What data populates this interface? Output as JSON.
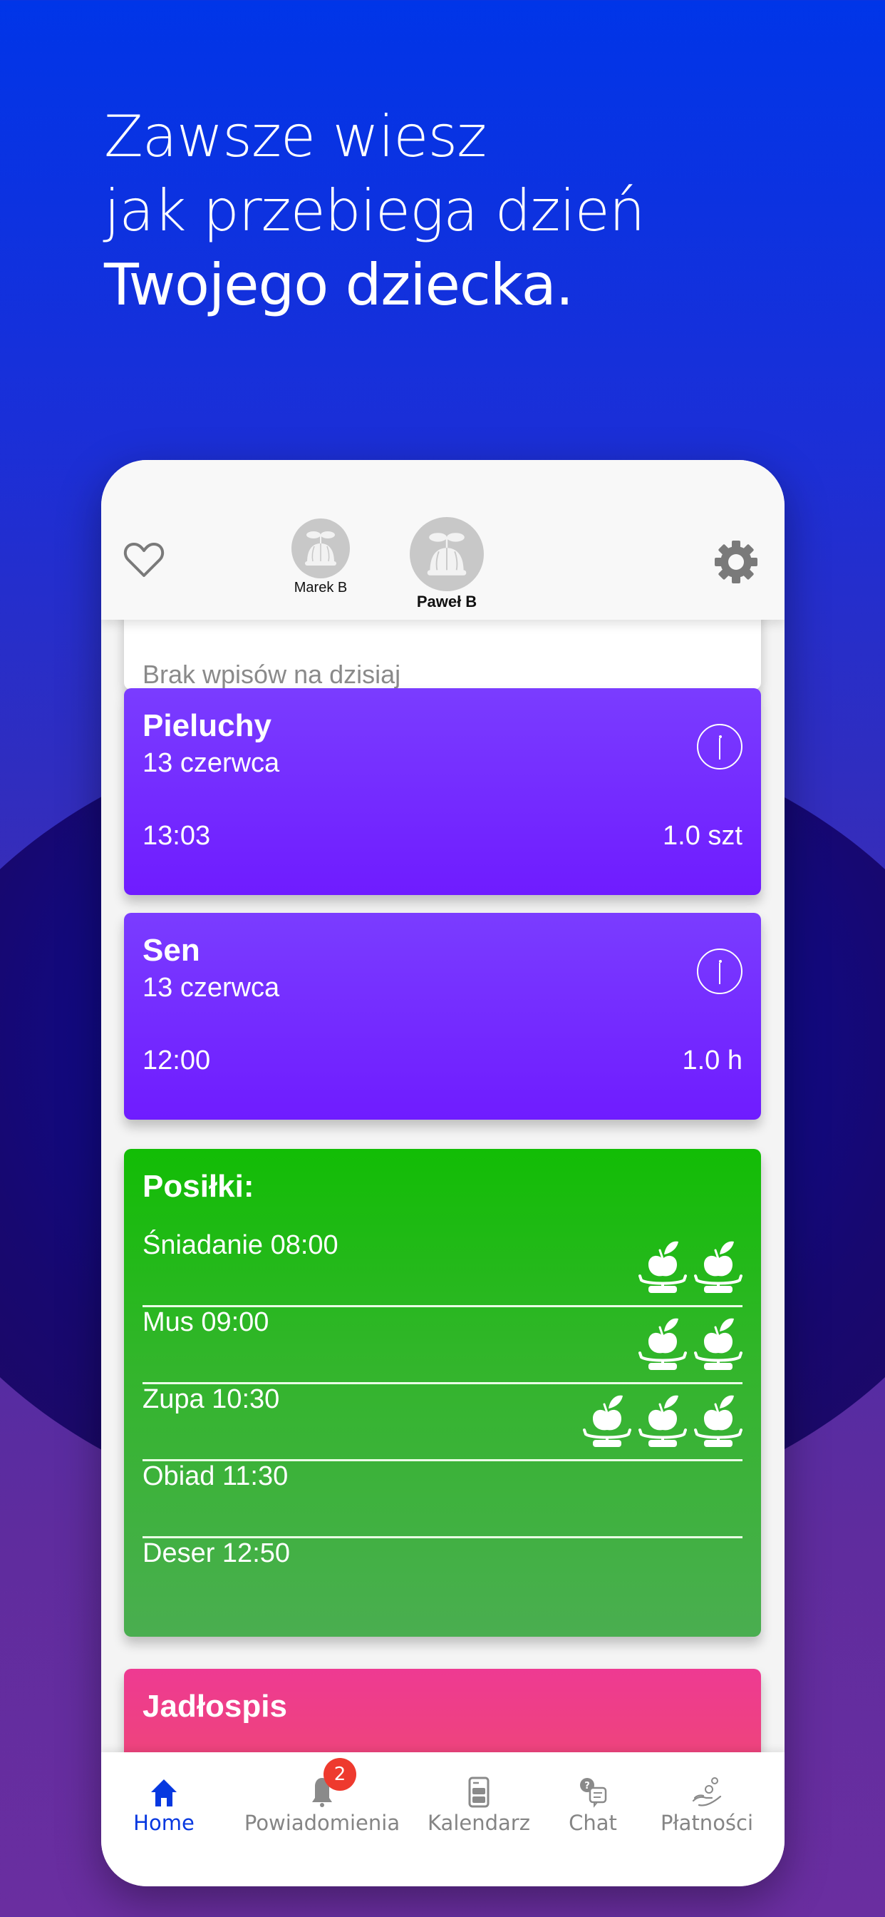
{
  "headline": {
    "line1": "Zawsze wiesz",
    "line2": "jak przebiega dzień",
    "line3": "Twojego dziecka."
  },
  "topbar": {
    "children": [
      {
        "name": "Marek B",
        "selected": false
      },
      {
        "name": "Paweł B",
        "selected": true
      }
    ]
  },
  "feed": {
    "empty_text": "Brak wpisów na dzisiaj",
    "cards": [
      {
        "title": "Pieluchy",
        "date": "13 czerwca",
        "time": "13:03",
        "quantity": "1.0 szt",
        "color": "#7228ff"
      },
      {
        "title": "Sen",
        "date": "13 czerwca",
        "time": "12:00",
        "quantity": "1.0 h",
        "color": "#7228ff"
      }
    ],
    "meals": {
      "title": "Posiłki:",
      "color": "#22b81a",
      "items": [
        {
          "label": "Śniadanie 08:00",
          "portions": 2
        },
        {
          "label": "Mus 09:00",
          "portions": 2
        },
        {
          "label": "Zupa 10:30",
          "portions": 3
        },
        {
          "label": "Obiad 11:30",
          "portions": 0
        },
        {
          "label": "Deser 12:50",
          "portions": 0
        }
      ]
    },
    "menu_card": {
      "title": "Jadłospis",
      "color": "#ee3f82"
    }
  },
  "tabbar": {
    "active_color": "#0638e0",
    "items": [
      {
        "label": "Home",
        "icon": "home-icon",
        "active": true
      },
      {
        "label": "Powiadomienia",
        "icon": "bell-icon",
        "badge": "2"
      },
      {
        "label": "Kalendarz",
        "icon": "calendar-icon"
      },
      {
        "label": "Chat",
        "icon": "chat-icon"
      },
      {
        "label": "Płatności",
        "icon": "payments-icon"
      }
    ]
  }
}
